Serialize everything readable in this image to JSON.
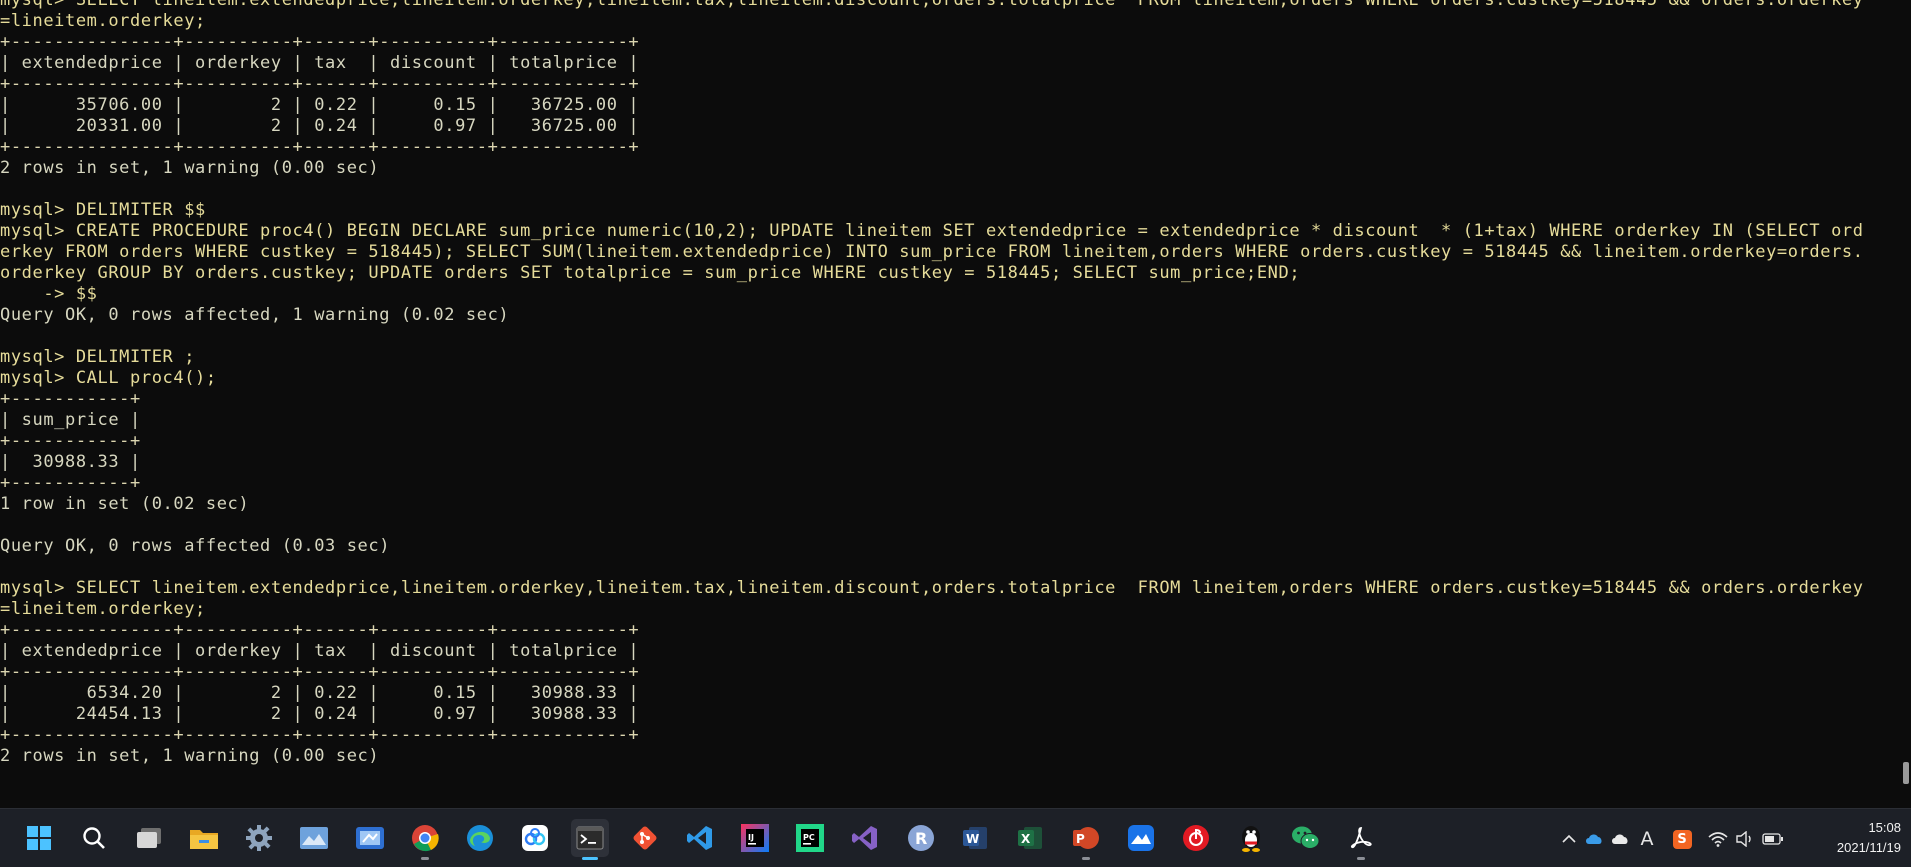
{
  "terminal": {
    "lines": [
      {
        "text": "mysql> SELECT lineitem.extendedprice,lineitem.orderkey,lineitem.tax,lineitem.discount,orders.totalprice  FROM lineitem,orders WHERE orders.custkey=518445 && orders.orderkey",
        "kind": "prompt"
      },
      {
        "text": "=lineitem.orderkey;",
        "kind": "prompt"
      },
      {
        "text": "+---------------+----------+------+----------+------------+",
        "kind": "border"
      },
      {
        "text": "| extendedprice | orderkey | tax  | discount | totalprice |",
        "kind": "result"
      },
      {
        "text": "+---------------+----------+------+----------+------------+",
        "kind": "border"
      },
      {
        "text": "|      35706.00 |        2 | 0.22 |     0.15 |   36725.00 |",
        "kind": "result"
      },
      {
        "text": "|      20331.00 |        2 | 0.24 |     0.97 |   36725.00 |",
        "kind": "result"
      },
      {
        "text": "+---------------+----------+------+----------+------------+",
        "kind": "border"
      },
      {
        "text": "2 rows in set, 1 warning (0.00 sec)",
        "kind": "result"
      },
      {
        "text": "",
        "kind": "result"
      },
      {
        "text": "mysql> DELIMITER $$",
        "kind": "prompt"
      },
      {
        "text": "mysql> CREATE PROCEDURE proc4() BEGIN DECLARE sum_price numeric(10,2); UPDATE lineitem SET extendedprice = extendedprice * discount  * (1+tax) WHERE orderkey IN (SELECT ord",
        "kind": "prompt"
      },
      {
        "text": "erkey FROM orders WHERE custkey = 518445); SELECT SUM(lineitem.extendedprice) INTO sum_price FROM lineitem,orders WHERE orders.custkey = 518445 && lineitem.orderkey=orders.",
        "kind": "prompt"
      },
      {
        "text": "orderkey GROUP BY orders.custkey; UPDATE orders SET totalprice = sum_price WHERE custkey = 518445; SELECT sum_price;END;",
        "kind": "prompt"
      },
      {
        "text": "    -> $$",
        "kind": "prompt"
      },
      {
        "text": "Query OK, 0 rows affected, 1 warning (0.02 sec)",
        "kind": "result"
      },
      {
        "text": "",
        "kind": "result"
      },
      {
        "text": "mysql> DELIMITER ;",
        "kind": "prompt"
      },
      {
        "text": "mysql> CALL proc4();",
        "kind": "prompt"
      },
      {
        "text": "+-----------+",
        "kind": "border"
      },
      {
        "text": "| sum_price |",
        "kind": "result"
      },
      {
        "text": "+-----------+",
        "kind": "border"
      },
      {
        "text": "|  30988.33 |",
        "kind": "result"
      },
      {
        "text": "+-----------+",
        "kind": "border"
      },
      {
        "text": "1 row in set (0.02 sec)",
        "kind": "result"
      },
      {
        "text": "",
        "kind": "result"
      },
      {
        "text": "Query OK, 0 rows affected (0.03 sec)",
        "kind": "result"
      },
      {
        "text": "",
        "kind": "result"
      },
      {
        "text": "mysql> SELECT lineitem.extendedprice,lineitem.orderkey,lineitem.tax,lineitem.discount,orders.totalprice  FROM lineitem,orders WHERE orders.custkey=518445 && orders.orderkey",
        "kind": "prompt"
      },
      {
        "text": "=lineitem.orderkey;",
        "kind": "prompt"
      },
      {
        "text": "+---------------+----------+------+----------+------------+",
        "kind": "border"
      },
      {
        "text": "| extendedprice | orderkey | tax  | discount | totalprice |",
        "kind": "result"
      },
      {
        "text": "+---------------+----------+------+----------+------------+",
        "kind": "border"
      },
      {
        "text": "|       6534.20 |        2 | 0.22 |     0.15 |   30988.33 |",
        "kind": "result"
      },
      {
        "text": "|      24454.13 |        2 | 0.24 |     0.97 |   30988.33 |",
        "kind": "result"
      },
      {
        "text": "+---------------+----------+------+----------+------------+",
        "kind": "border"
      },
      {
        "text": "2 rows in set, 1 warning (0.00 sec)",
        "kind": "result"
      }
    ]
  },
  "taskbar": {
    "apps": [
      {
        "id": "start",
        "icon": "windows-start-icon",
        "active": false,
        "running": false,
        "bg": "transparent",
        "fg": "#4cc2ff",
        "glyph": ""
      },
      {
        "id": "search",
        "icon": "search-icon",
        "active": false,
        "running": false,
        "bg": "transparent",
        "fg": "#ffffff",
        "glyph": ""
      },
      {
        "id": "task-view",
        "icon": "task-view-icon",
        "active": false,
        "running": false,
        "bg": "transparent",
        "fg": "#cfcfcf",
        "glyph": ""
      },
      {
        "id": "file-explorer",
        "icon": "folder-icon",
        "active": false,
        "running": false,
        "bg": "transparent",
        "fg": "#f2c14e",
        "glyph": ""
      },
      {
        "id": "settings",
        "icon": "gear-icon",
        "active": false,
        "running": false,
        "bg": "transparent",
        "fg": "#9ab0c8",
        "glyph": ""
      },
      {
        "id": "photos",
        "icon": "photos-icon",
        "active": false,
        "running": false,
        "bg": "#5b8ec9",
        "fg": "#ffffff",
        "glyph": ""
      },
      {
        "id": "snipping",
        "icon": "snipping-tool-icon",
        "active": false,
        "running": false,
        "bg": "#3a7bd5",
        "fg": "#ffffff",
        "glyph": ""
      },
      {
        "id": "chrome",
        "icon": "chrome-icon",
        "active": false,
        "running": true,
        "bg": "transparent",
        "fg": "#ffffff",
        "glyph": ""
      },
      {
        "id": "edge",
        "icon": "edge-icon",
        "active": false,
        "running": false,
        "bg": "transparent",
        "fg": "#ffffff",
        "glyph": ""
      },
      {
        "id": "baidu-netdisk",
        "icon": "cloud-drive-icon",
        "active": false,
        "running": false,
        "bg": "#ffffff",
        "fg": "#2d7cf6",
        "glyph": ""
      },
      {
        "id": "terminal",
        "icon": "terminal-icon",
        "active": true,
        "running": true,
        "bg": "#2f2f2f",
        "fg": "#ffffff",
        "glyph": ""
      },
      {
        "id": "git",
        "icon": "git-icon",
        "active": false,
        "running": false,
        "bg": "transparent",
        "fg": "#f05133",
        "glyph": ""
      },
      {
        "id": "vscode",
        "icon": "vscode-icon",
        "active": false,
        "running": false,
        "bg": "transparent",
        "fg": "#2f9ae8",
        "glyph": ""
      },
      {
        "id": "intellij",
        "icon": "intellij-icon",
        "active": false,
        "running": false,
        "bg": "#e8336b",
        "fg": "#ffffff",
        "glyph": "IJ"
      },
      {
        "id": "pycharm",
        "icon": "pycharm-icon",
        "active": false,
        "running": false,
        "bg": "#21d789",
        "fg": "#000000",
        "glyph": "PC"
      },
      {
        "id": "visual-studio",
        "icon": "visual-studio-icon",
        "active": false,
        "running": false,
        "bg": "transparent",
        "fg": "#8661c5",
        "glyph": ""
      },
      {
        "id": "r",
        "icon": "r-icon",
        "active": false,
        "running": false,
        "bg": "#7d9dd1",
        "fg": "#ffffff",
        "glyph": "R"
      },
      {
        "id": "word",
        "icon": "word-icon",
        "active": false,
        "running": false,
        "bg": "#2b5797",
        "fg": "#ffffff",
        "glyph": "W"
      },
      {
        "id": "excel",
        "icon": "excel-icon",
        "active": false,
        "running": false,
        "bg": "#1e7145",
        "fg": "#ffffff",
        "glyph": "X"
      },
      {
        "id": "powerpoint",
        "icon": "powerpoint-icon",
        "active": false,
        "running": true,
        "bg": "#d24726",
        "fg": "#ffffff",
        "glyph": "P"
      },
      {
        "id": "lark",
        "icon": "lark-icon",
        "active": false,
        "running": false,
        "bg": "#1a73e8",
        "fg": "#ffffff",
        "glyph": ""
      },
      {
        "id": "netease-music",
        "icon": "music-icon",
        "active": false,
        "running": false,
        "bg": "#e21a23",
        "fg": "#ffffff",
        "glyph": ""
      },
      {
        "id": "qq",
        "icon": "qq-penguin-icon",
        "active": false,
        "running": false,
        "bg": "transparent",
        "fg": "#ffffff",
        "glyph": ""
      },
      {
        "id": "wechat",
        "icon": "wechat-icon",
        "active": false,
        "running": false,
        "bg": "transparent",
        "fg": "#2aae67",
        "glyph": ""
      },
      {
        "id": "acrobat",
        "icon": "acrobat-icon",
        "active": false,
        "running": true,
        "bg": "transparent",
        "fg": "#ffffff",
        "glyph": ""
      }
    ],
    "tray": {
      "icons": [
        "chevron-up-icon",
        "onedrive-icon",
        "cloud-icon",
        "ime-icon",
        "sogou-icon",
        "wifi-icon",
        "volume-icon",
        "battery-icon"
      ],
      "ime_label": "A",
      "sogou_label": "S",
      "time": "15:08",
      "date": "2021/11/19"
    }
  }
}
